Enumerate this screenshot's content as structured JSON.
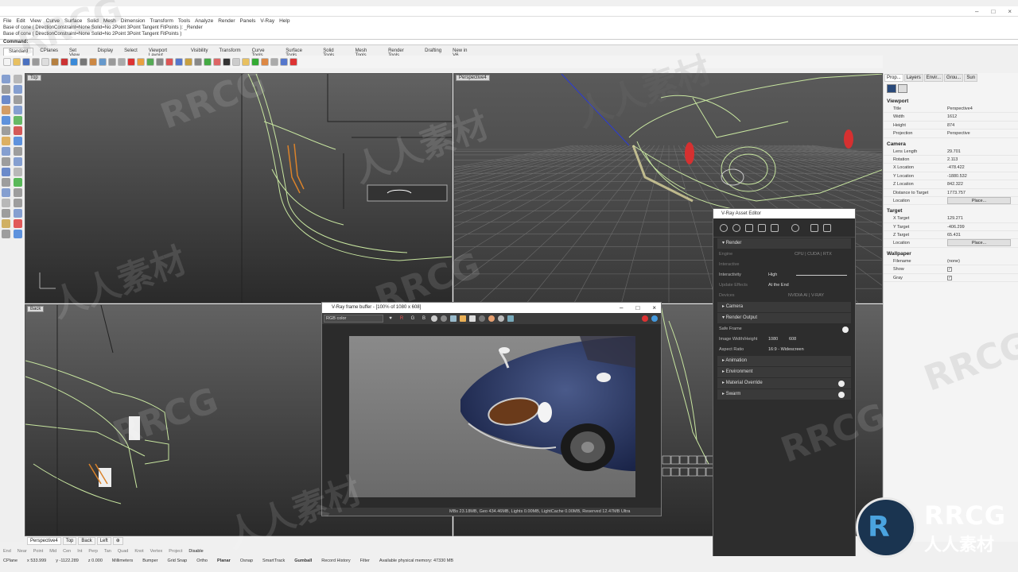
{
  "app": {
    "menu": [
      "File",
      "Edit",
      "View",
      "Curve",
      "Surface",
      "Solid",
      "Mesh",
      "Dimension",
      "Transform",
      "Tools",
      "Analyze",
      "Render",
      "Panels",
      "V-Ray",
      "Help"
    ]
  },
  "command": {
    "history": [
      "Base of cone ( DirectionConstraint=None  Solid=No  2Point  3Point  Tangent  FitPoints ): _Render",
      "Base of cone ( DirectionConstraint=None  Solid=No  2Point  3Point  Tangent  FitPoints )"
    ],
    "prompt": "Command:"
  },
  "tabs": [
    "Standard",
    "CPlanes",
    "Set View",
    "Display",
    "Select",
    "Viewport Layout",
    "Visibility",
    "Transform",
    "Curve Tools",
    "Surface Tools",
    "Solid Tools",
    "Mesh Tools",
    "Render Tools",
    "Drafting",
    "New in V6"
  ],
  "viewports": {
    "top": "Top",
    "perspective": "Perspective4",
    "back": "Back"
  },
  "properties": {
    "tabs": [
      "Prop...",
      "Layers",
      "Envir...",
      "Grou...",
      "Sun"
    ],
    "viewport_header": "Viewport",
    "viewport": [
      {
        "k": "Title",
        "v": "Perspective4"
      },
      {
        "k": "Width",
        "v": "1612"
      },
      {
        "k": "Height",
        "v": "874"
      },
      {
        "k": "Projection",
        "v": "Perspective"
      }
    ],
    "camera_header": "Camera",
    "camera": [
      {
        "k": "Lens Length",
        "v": "29.701"
      },
      {
        "k": "Rotation",
        "v": "2.113"
      },
      {
        "k": "X Location",
        "v": "-478.422"
      },
      {
        "k": "Y Location",
        "v": "-1880.532"
      },
      {
        "k": "Z Location",
        "v": "842.322"
      },
      {
        "k": "Distance to Target",
        "v": "1773.757"
      }
    ],
    "camera_location_label": "Location",
    "place_label": "Place...",
    "target_header": "Target",
    "target": [
      {
        "k": "X Target",
        "v": "129.271"
      },
      {
        "k": "Y Target",
        "v": "-406.299"
      },
      {
        "k": "Z Target",
        "v": "65.431"
      }
    ],
    "target_location_label": "Location",
    "wallpaper_header": "Wallpaper",
    "wallpaper_filename_label": "Filename",
    "wallpaper_filename": "(none)",
    "wallpaper_show_label": "Show",
    "wallpaper_gray_label": "Gray"
  },
  "vfb": {
    "title": "V-Ray frame buffer - [100% of 1080 x 608]",
    "channel": "RGB color",
    "channels": [
      "R",
      "G",
      "B"
    ],
    "status": "MBs 23.18MB, Geo 434.46MB, Lights 0.00MB, LightCache 0.00MB, Reserved 12.47MB Ultra"
  },
  "assetEditor": {
    "title": "V-Ray Asset Editor",
    "render_section": "Render",
    "engine": {
      "label": "Engine",
      "opts": "CPU  |  CUDA  |  RTX"
    },
    "interactive": "Interactive",
    "interactivity": {
      "label": "Interactivity",
      "value": "High"
    },
    "update_effects": {
      "label": "Update Effects",
      "value": "At the End"
    },
    "devices": {
      "label": "Devices",
      "value": "NVIDIA AI  |  V-RAY"
    },
    "camera_section": "Camera",
    "render_output_section": "Render Output",
    "safe_frame": "Safe Frame",
    "image_size": {
      "label": "Image Width/Height",
      "w": "1080",
      "h": "608"
    },
    "aspect": {
      "label": "Aspect Ratio",
      "value": "16:9 - Widescreen"
    },
    "animation": "Animation",
    "environment": "Environment",
    "material_override": "Material Override",
    "swarm": "Swarm"
  },
  "viewtabs": [
    "Perspective4",
    "Top",
    "Back",
    "Left"
  ],
  "osnap": [
    "End",
    "Near",
    "Point",
    "Mid",
    "Cen",
    "Int",
    "Perp",
    "Tan",
    "Quad",
    "Knot",
    "Vertex",
    "Project",
    "Disable"
  ],
  "status": {
    "cplane": "CPlane",
    "x": "x 533.999",
    "y": "y -1122.289",
    "z": "z 0.000",
    "units": "Millimeters",
    "layer": "Bumper",
    "items": [
      "Grid Snap",
      "Ortho",
      "Planar",
      "Osnap",
      "SmartTrack",
      "Gumball",
      "Record History",
      "Filter"
    ],
    "memory": "Available physical memory: 47330 MB"
  },
  "logo": {
    "t1": "RRCG",
    "t2": "人人素材"
  },
  "colors": {
    "viewport_bg": "#3e3e3e",
    "vray_bg": "#2d2d2d",
    "car_lines": "#c8e6a0",
    "car_paint": "#2a3a6a",
    "accent": "#1e6fc8"
  }
}
